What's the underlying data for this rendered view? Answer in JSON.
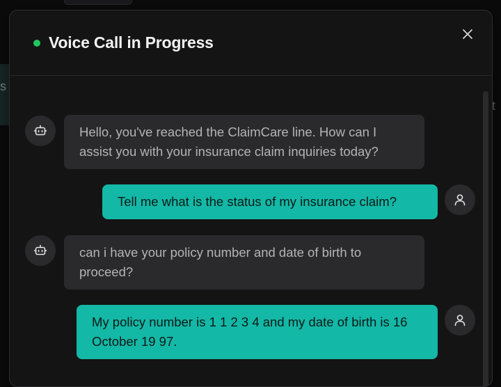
{
  "dialog": {
    "title": "Voice Call in Progress",
    "status_color": "#22c55e",
    "close_icon": "close-icon"
  },
  "background": {
    "left_fragment": "s",
    "right_fragment": "it"
  },
  "messages": [
    {
      "role": "assistant",
      "avatar_icon": "bot-icon",
      "text": "Hello, you've reached the ClaimCare line. How can I assist you with your insurance claim inquiries today?"
    },
    {
      "role": "user",
      "avatar_icon": "user-icon",
      "text": "Tell me what is the status of my insurance claim?"
    },
    {
      "role": "assistant",
      "avatar_icon": "bot-icon",
      "text": "can i have your policy number and date of birth to proceed?"
    },
    {
      "role": "user",
      "avatar_icon": "user-icon",
      "text": "My policy number is 1 1 2 3 4 and my date of birth is 16 October 19 97."
    }
  ],
  "colors": {
    "user_bubble": "#14b8a6",
    "assistant_bubble": "#2a2a2c",
    "modal_bg": "#141415"
  }
}
